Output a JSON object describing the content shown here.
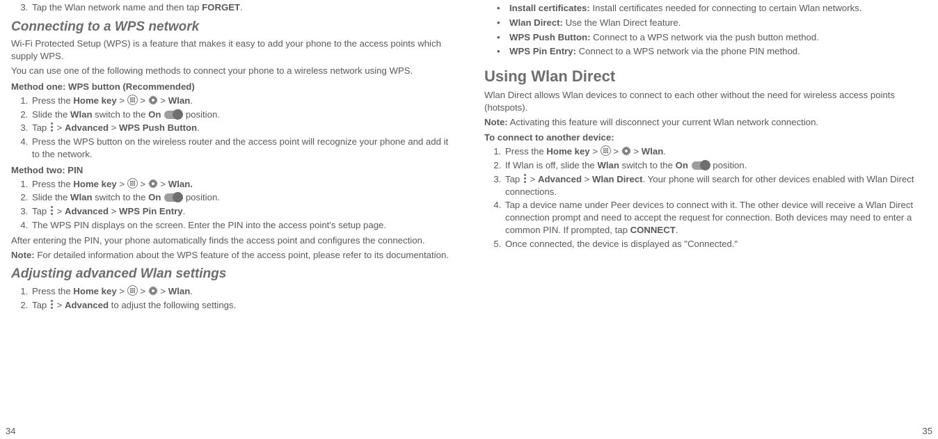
{
  "left": {
    "pagenum": "34",
    "forget_item": {
      "num": "3.",
      "pre": "Tap the Wlan network name and then tap ",
      "bold": "FORGET",
      "post": "."
    },
    "sec_wps_title": "Connecting to a WPS network",
    "wps_p1": "Wi-Fi Protected Setup (WPS) is a feature that makes it easy to add your phone to the access points which supply WPS.",
    "wps_p2": "You can use one of the following methods to connect your phone to a wireless network using WPS.",
    "method1_title": "Method one: WPS button (Recommended)",
    "m1": {
      "s1": {
        "num": "1.",
        "pre": "Press the ",
        "b1": "Home key",
        "mid1": " > ",
        "mid2": " > ",
        "mid3": " > ",
        "b2": "Wlan",
        "post": "."
      },
      "s2": {
        "num": "2.",
        "pre": "Slide the ",
        "b1": "Wlan",
        "mid1": " switch to the ",
        "b2": "On",
        "post": " position."
      },
      "s3": {
        "num": "3.",
        "pre": "Tap ",
        "mid1": " > ",
        "b1": "Advanced",
        "mid2": " > ",
        "b2": "WPS Push Button",
        "post": "."
      },
      "s4": {
        "num": "4.",
        "text": "Press the WPS button on the wireless router and the access point will recognize your phone and add it to the network."
      }
    },
    "method2_title": "Method two: PIN",
    "m2": {
      "s1": {
        "num": "1.",
        "pre": "Press the ",
        "b1": "Home key",
        "mid1": " > ",
        "mid2": " > ",
        "mid3": " > ",
        "b2": "Wlan.",
        "post": ""
      },
      "s2": {
        "num": "2.",
        "pre": "Slide the ",
        "b1": "Wlan",
        "mid1": " switch to the ",
        "b2": "On",
        "post": " position."
      },
      "s3": {
        "num": "3.",
        "pre": "Tap ",
        "mid1": " > ",
        "b1": "Advanced",
        "mid2": " > ",
        "b2": "WPS Pin Entry",
        "post": "."
      },
      "s4": {
        "num": "4.",
        "text": "The WPS PIN displays on the screen. Enter the PIN into the access point's setup page."
      }
    },
    "after_pin": "After entering the PIN, your phone automatically finds the access point and configures the connection.",
    "note_label": "Note:",
    "note_text": " For detailed information about the WPS feature of the access point, please refer to its documentation.",
    "sec_adv_title": "Adjusting advanced Wlan settings",
    "adv": {
      "s1": {
        "num": "1.",
        "pre": "Press the ",
        "b1": "Home key",
        "mid1": " > ",
        "mid2": " > ",
        "mid3": " > ",
        "b2": "Wlan",
        "post": "."
      },
      "s2": {
        "num": "2.",
        "pre": "Tap ",
        "mid1": " > ",
        "b1": "Advanced",
        "post": " to adjust the following settings."
      }
    }
  },
  "right": {
    "pagenum": "35",
    "bullets": {
      "a": {
        "b": "Install certificates:",
        "t": " Install certificates needed for connecting to certain Wlan networks."
      },
      "b": {
        "b": "Wlan Direct:",
        "t": " Use the Wlan Direct feature."
      },
      "c": {
        "b": "WPS Push Button:",
        "t": " Connect to a WPS network via the push button method."
      },
      "d": {
        "b": "WPS Pin Entry:",
        "t": " Connect to a WPS network via the phone PIN method."
      }
    },
    "h2": "Using Wlan Direct",
    "p1": "Wlan Direct allows Wlan devices to connect to each other without the need for wireless access points (hotspots).",
    "note_label": "Note:",
    "note_text": " Activating this feature will disconnect your current Wlan network connection.",
    "sub": "To connect to another device:",
    "steps": {
      "s1": {
        "num": "1.",
        "pre": "Press the ",
        "b1": "Home key",
        "mid1": " > ",
        "mid2": " > ",
        "mid3": " > ",
        "b2": "Wlan",
        "post": "."
      },
      "s2": {
        "num": "2.",
        "pre": "If Wlan is off, slide the ",
        "b1": "Wlan",
        "mid1": " switch to the ",
        "b2": "On",
        "post": " position."
      },
      "s3": {
        "num": "3.",
        "pre": "Tap ",
        "mid1": " > ",
        "b1": "Advanced",
        "mid2": " > ",
        "b2": "Wlan Direct",
        "post": ". Your phone will search for other devices enabled with Wlan Direct connections."
      },
      "s4": {
        "num": "4.",
        "pre": "Tap a device name under Peer devices to connect with it. The other device will receive a Wlan Direct connection prompt and need to accept the request for connection. Both devices may need to enter a common PIN. If prompted, tap ",
        "b1": "CONNECT",
        "post": "."
      },
      "s5": {
        "num": "5.",
        "text": "Once connected, the device is displayed as \"Connected.\""
      }
    }
  }
}
